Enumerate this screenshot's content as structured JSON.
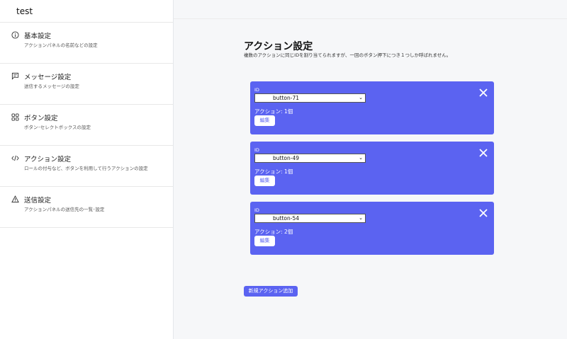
{
  "app": {
    "title": "test"
  },
  "sidebar": {
    "items": [
      {
        "title": "基本設定",
        "subtitle": "アクションパネルの名前などの設定",
        "icon": "info-icon"
      },
      {
        "title": "メッセージ設定",
        "subtitle": "送信するメッセージの設定",
        "icon": "message-icon"
      },
      {
        "title": "ボタン設定",
        "subtitle": "ボタン･セレクトボックスの設定",
        "icon": "grid-icon"
      },
      {
        "title": "アクション設定",
        "subtitle": "ロールの付与など、ボタンを利用して行うアクションの設定",
        "icon": "code-icon"
      },
      {
        "title": "送信設定",
        "subtitle": "アクションパネルの送信先の一覧･設定",
        "icon": "warning-icon"
      }
    ]
  },
  "main": {
    "title": "アクション設定",
    "description": "複数のアクションに同じIDを割り当てられますが、一回のボタン押下につき１つしか呼ばれません。",
    "id_label": "ID",
    "edit_label": "編集",
    "add_button_label": "新規アクション追加",
    "accent_color": "#5b63f1",
    "cards": [
      {
        "selected_id": "button-71",
        "count_text": "アクション: 1個"
      },
      {
        "selected_id": "button-49",
        "count_text": "アクション: 1個"
      },
      {
        "selected_id": "button-54",
        "count_text": "アクション: 2個"
      }
    ]
  }
}
